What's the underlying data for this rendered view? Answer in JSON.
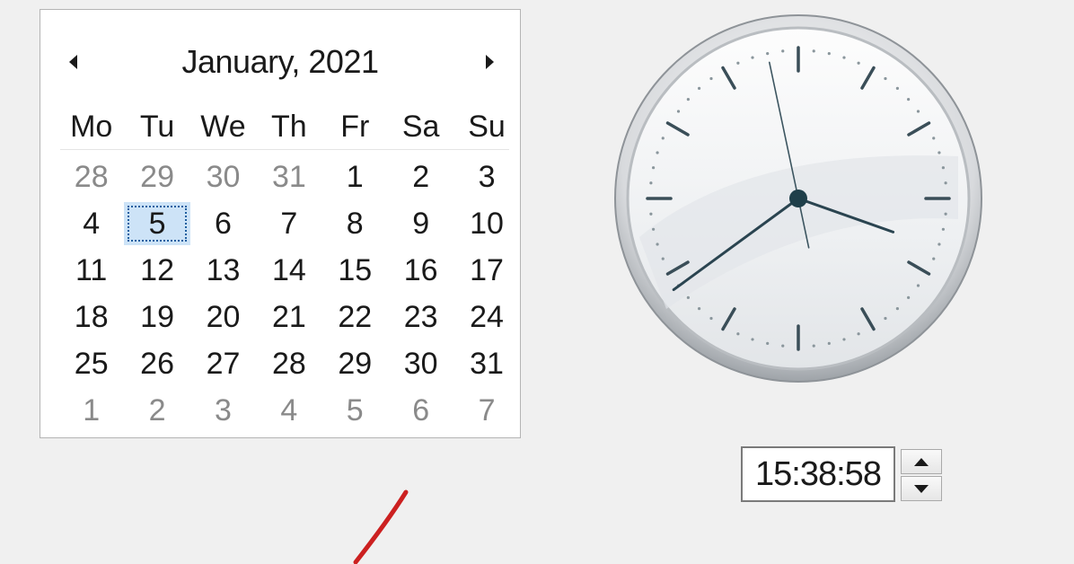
{
  "calendar": {
    "month_title": "January, 2021",
    "prev_label": "◄",
    "next_label": "►",
    "weekdays": [
      "Mo",
      "Tu",
      "We",
      "Th",
      "Fr",
      "Sa",
      "Su"
    ],
    "weeks": [
      [
        "28",
        "29",
        "30",
        "31",
        "1",
        "2",
        "3"
      ],
      [
        "4",
        "5",
        "6",
        "7",
        "8",
        "9",
        "10"
      ],
      [
        "11",
        "12",
        "13",
        "14",
        "15",
        "16",
        "17"
      ],
      [
        "18",
        "19",
        "20",
        "21",
        "22",
        "23",
        "24"
      ],
      [
        "25",
        "26",
        "27",
        "28",
        "29",
        "30",
        "31"
      ],
      [
        "1",
        "2",
        "3",
        "4",
        "5",
        "6",
        "7"
      ]
    ],
    "selected_day": "5",
    "colors": {
      "selected_bg": "#cde3f7",
      "selected_outline": "#1f5fa0",
      "muted_text": "#8a8a8a"
    }
  },
  "clock": {
    "time_value": "15:38:58",
    "hour": 15,
    "minute": 38,
    "second": 58
  },
  "spinner": {
    "up_icon": "chevron-up-icon",
    "down_icon": "chevron-down-icon"
  },
  "annotation": {
    "color": "#cc2020"
  }
}
